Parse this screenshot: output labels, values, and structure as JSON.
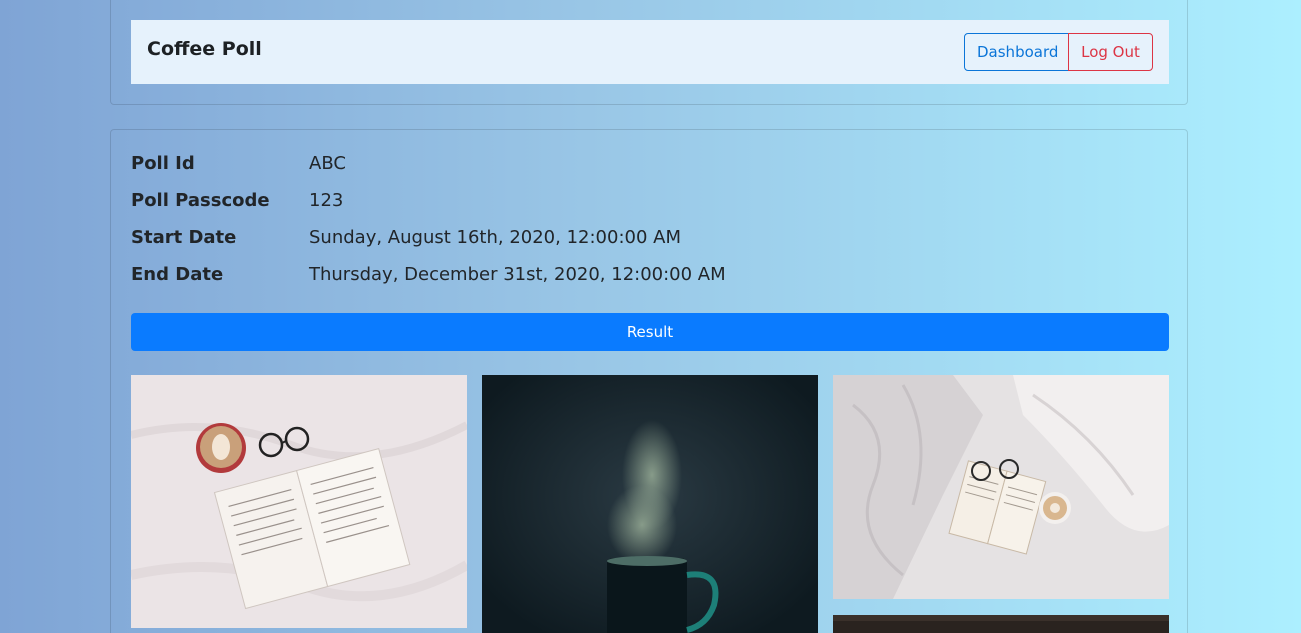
{
  "navbar": {
    "brand": "Coffee Poll",
    "dashboard_label": "Dashboard",
    "logout_label": "Log Out"
  },
  "poll": {
    "fields": [
      {
        "label": "Poll Id",
        "value": "ABC"
      },
      {
        "label": "Poll Passcode",
        "value": "123"
      },
      {
        "label": "Start Date",
        "value": "Sunday, August 16th, 2020, 12:00:00 AM"
      },
      {
        "label": "End Date",
        "value": "Thursday, December 31st, 2020, 12:00:00 AM"
      }
    ],
    "result_label": "Result"
  },
  "colors": {
    "primary": "#0a7bff",
    "danger": "#dc3545",
    "nav_bg": "#e6f2fc"
  }
}
